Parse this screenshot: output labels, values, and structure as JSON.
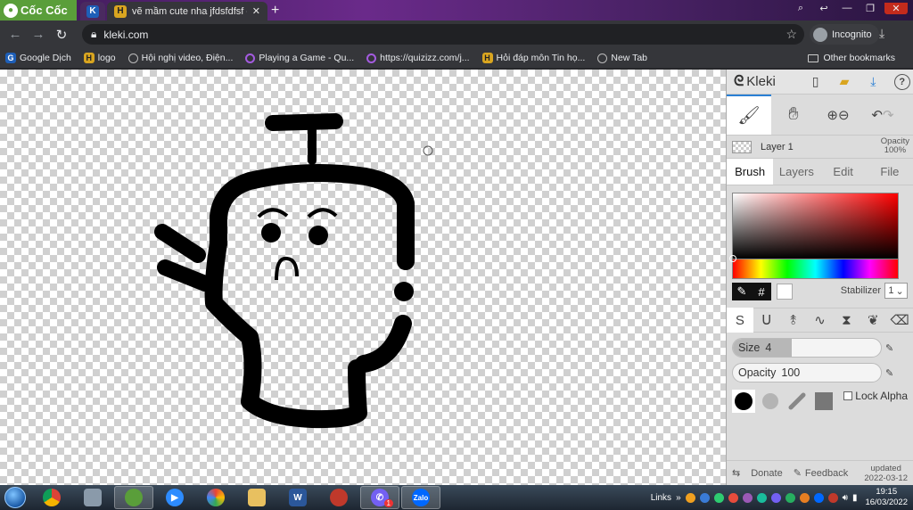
{
  "browser": {
    "brand": "Cốc Cốc",
    "tab": {
      "title": "vẽ mầm cute nha jfdsfdfsf cả"
    },
    "address": "kleki.com",
    "incognito_label": "Incognito",
    "bookmarks": [
      {
        "label": "Google Dịch",
        "icon": "translate-icon"
      },
      {
        "label": "logo",
        "icon": "h-icon"
      },
      {
        "label": "Hội nghị video, Điện...",
        "icon": "globe-icon"
      },
      {
        "label": "Playing a Game - Qu...",
        "icon": "quizizz-icon"
      },
      {
        "label": "https://quizizz.com/j...",
        "icon": "quizizz-icon"
      },
      {
        "label": "Hỏi đáp môn Tin họ...",
        "icon": "h-icon"
      },
      {
        "label": "New Tab",
        "icon": "globe-icon"
      }
    ],
    "other_bookmarks": "Other bookmarks"
  },
  "kleki": {
    "brand": "Kleki",
    "layer": {
      "name": "Layer 1",
      "opacity_label": "Opacity",
      "opacity_value": "100%"
    },
    "tabs": [
      "Brush",
      "Layers",
      "Edit",
      "File"
    ],
    "active_tab": "Brush",
    "stabilizer_label": "Stabilizer",
    "stabilizer_value": "1",
    "size": {
      "label": "Size",
      "value": "4",
      "fraction": 0.4
    },
    "opacity": {
      "label": "Opacity",
      "value": "100",
      "fraction": 1.0
    },
    "lock_alpha": "Lock Alpha",
    "footer": {
      "donate": "Donate",
      "feedback": "Feedback",
      "updated_label": "updated",
      "updated_date": "2022-03-12"
    },
    "colors": {
      "primary": "#000000",
      "secondary": "#ffffff"
    }
  },
  "taskbar": {
    "links_label": "Links",
    "time": "19:15",
    "date": "16/03/2022",
    "viber_badge": "1",
    "word_label": "W",
    "zalo_label": "Zalo"
  }
}
